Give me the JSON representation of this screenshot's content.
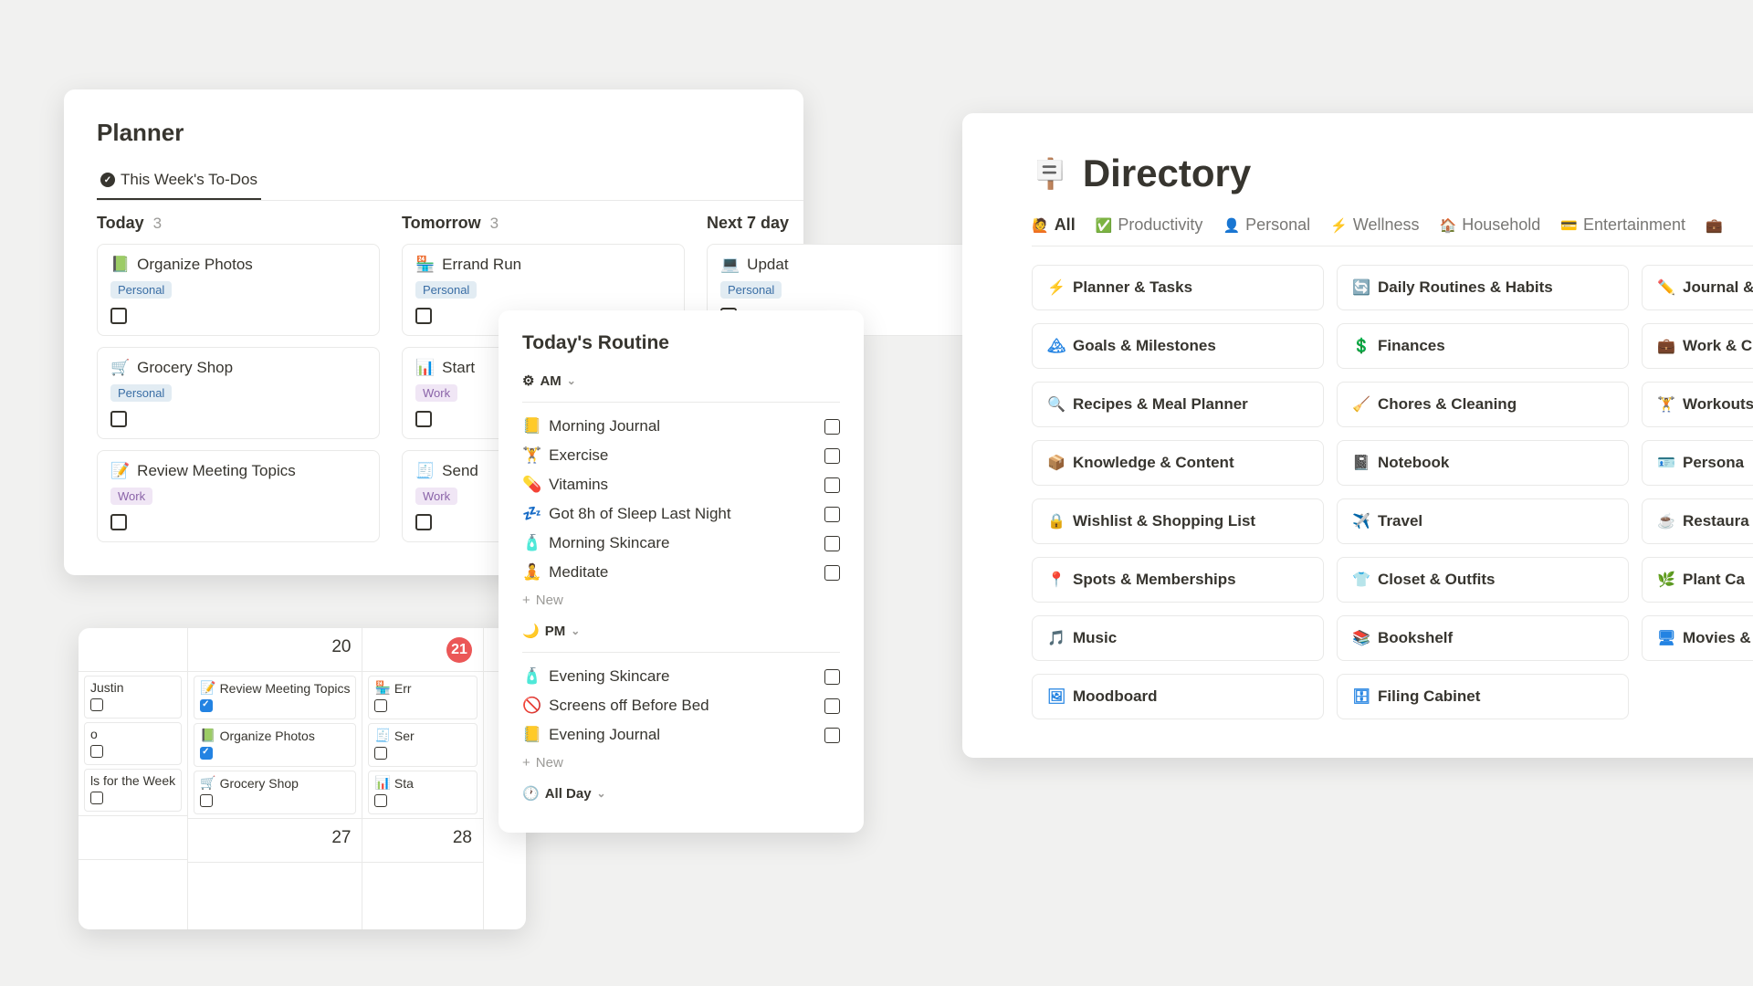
{
  "planner": {
    "title": "Planner",
    "tab": "This Week's To-Dos",
    "groups": [
      {
        "name": "Today",
        "count": "3",
        "tasks": [
          {
            "emoji": "📗",
            "title": "Organize Photos",
            "tag": "Personal",
            "tagClass": "tag-personal"
          },
          {
            "emoji": "🛒",
            "title": "Grocery Shop",
            "tag": "Personal",
            "tagClass": "tag-personal"
          },
          {
            "emoji": "📝",
            "title": "Review Meeting Topics",
            "tag": "Work",
            "tagClass": "tag-work"
          }
        ]
      },
      {
        "name": "Tomorrow",
        "count": "3",
        "tasks": [
          {
            "emoji": "🏪",
            "title": "Errand Run",
            "tag": "Personal",
            "tagClass": "tag-personal"
          },
          {
            "emoji": "📊",
            "title": "Start",
            "tag": "Work",
            "tagClass": "tag-work"
          },
          {
            "emoji": "🧾",
            "title": "Send",
            "tag": "Work",
            "tagClass": "tag-work"
          }
        ]
      },
      {
        "name": "Next 7 day",
        "count": "",
        "tasks": [
          {
            "emoji": "💻",
            "title": "Updat",
            "tag": "Personal",
            "tagClass": "tag-personal"
          }
        ]
      }
    ]
  },
  "calendar": {
    "row1": {
      "col1_day": "",
      "col2_day": "20",
      "col3_day_today": "21",
      "col4_day": ""
    },
    "cells": {
      "col1": [
        {
          "title": "Justin",
          "done": false
        },
        {
          "title": "o",
          "done": false
        },
        {
          "title": "ls for the Week",
          "done": false
        }
      ],
      "col2": [
        {
          "emoji": "📝",
          "title": "Review Meeting Topics",
          "done": true
        },
        {
          "emoji": "📗",
          "title": "Organize Photos",
          "done": true
        },
        {
          "emoji": "🛒",
          "title": "Grocery Shop",
          "done": false
        }
      ],
      "col3": [
        {
          "emoji": "🏪",
          "title": "Err",
          "done": false
        },
        {
          "emoji": "🧾",
          "title": "Ser",
          "done": false
        },
        {
          "emoji": "📊",
          "title": "Sta",
          "done": false
        }
      ]
    },
    "row2": {
      "col2_day": "27",
      "col3_day": "28"
    }
  },
  "routine": {
    "title": "Today's Routine",
    "sections": [
      {
        "icon": "⚙",
        "label": "AM",
        "items": [
          {
            "emoji": "📒",
            "label": "Morning Journal"
          },
          {
            "emoji": "🏋️",
            "label": "Exercise"
          },
          {
            "emoji": "💊",
            "label": "Vitamins"
          },
          {
            "emoji": "💤",
            "label": "Got 8h of Sleep Last Night"
          },
          {
            "emoji": "🧴",
            "label": "Morning Skincare"
          },
          {
            "emoji": "🧘",
            "label": "Meditate"
          }
        ]
      },
      {
        "icon": "🌙",
        "label": "PM",
        "items": [
          {
            "emoji": "🧴",
            "label": "Evening Skincare"
          },
          {
            "emoji": "🚫",
            "label": "Screens off Before Bed"
          },
          {
            "emoji": "📒",
            "label": "Evening Journal"
          }
        ]
      },
      {
        "icon": "🕐",
        "label": "All Day",
        "items": []
      }
    ],
    "new_label": "New"
  },
  "directory": {
    "title": "Directory",
    "sign_emoji": "🪧",
    "tabs": [
      {
        "icon": "🙋",
        "label": "All",
        "active": true
      },
      {
        "icon": "✅",
        "label": "Productivity"
      },
      {
        "icon": "👤",
        "label": "Personal"
      },
      {
        "icon": "⚡",
        "label": "Wellness"
      },
      {
        "icon": "🏠",
        "label": "Household"
      },
      {
        "icon": "💳",
        "label": "Entertainment"
      },
      {
        "icon": "💼",
        "label": ""
      }
    ],
    "items": [
      {
        "icon": "⚡",
        "label": "Planner & Tasks"
      },
      {
        "icon": "🔄",
        "label": "Daily Routines & Habits"
      },
      {
        "icon": "✏️",
        "label": "Journal &"
      },
      {
        "icon": "🏔",
        "label": "Goals & Milestones"
      },
      {
        "icon": "💲",
        "label": "Finances"
      },
      {
        "icon": "💼",
        "label": "Work & C"
      },
      {
        "icon": "🔍",
        "label": "Recipes & Meal Planner"
      },
      {
        "icon": "🧹",
        "label": "Chores & Cleaning"
      },
      {
        "icon": "🏋️",
        "label": "Workouts"
      },
      {
        "icon": "📦",
        "label": "Knowledge & Content"
      },
      {
        "icon": "📓",
        "label": "Notebook"
      },
      {
        "icon": "🪪",
        "label": "Persona"
      },
      {
        "icon": "🔒",
        "label": "Wishlist & Shopping List"
      },
      {
        "icon": "✈️",
        "label": "Travel"
      },
      {
        "icon": "☕",
        "label": "Restaura"
      },
      {
        "icon": "📍",
        "label": "Spots & Memberships"
      },
      {
        "icon": "👕",
        "label": "Closet & Outfits"
      },
      {
        "icon": "🌿",
        "label": "Plant Ca"
      },
      {
        "icon": "🎵",
        "label": "Music"
      },
      {
        "icon": "📚",
        "label": "Bookshelf"
      },
      {
        "icon": "🖥",
        "label": "Movies &"
      },
      {
        "icon": "🖼",
        "label": "Moodboard"
      },
      {
        "icon": "🗄",
        "label": "Filing Cabinet"
      }
    ]
  }
}
